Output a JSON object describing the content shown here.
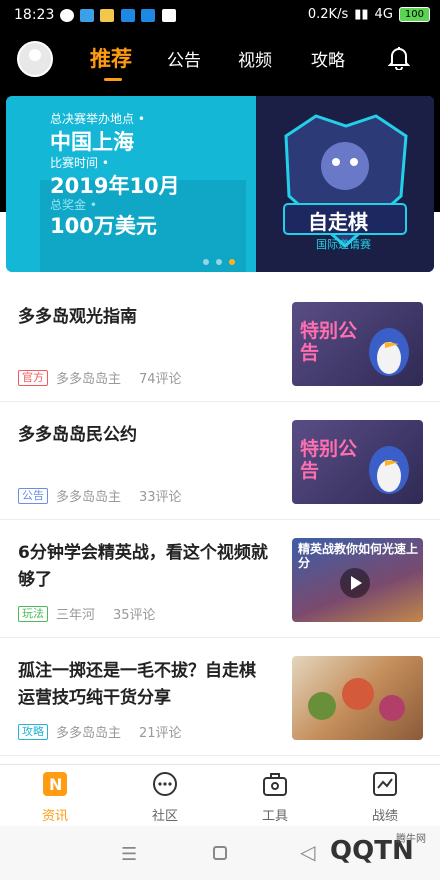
{
  "status": {
    "time": "18:23",
    "net": "0.2K/s",
    "signal": "4G",
    "battery": "100"
  },
  "nav": {
    "tabs": [
      {
        "label": "推荐"
      },
      {
        "label": "公告"
      },
      {
        "label": "视频"
      },
      {
        "label": "攻略"
      }
    ]
  },
  "banner": {
    "line1": "总决赛举办地点 •",
    "line2": "中国上海",
    "line3": "比赛时间 •",
    "line4": "2019年10月",
    "line5": "总奖金 •",
    "line6": "100万美元",
    "logo_text": "自走棋",
    "logo_sub": "国际邀请赛"
  },
  "articles": [
    {
      "title": "多多岛观光指南",
      "tag": "官方",
      "tag_color": "#f05a5a",
      "author": "多多岛岛主",
      "comments": "74评论",
      "thumb_text": "特别公告"
    },
    {
      "title": "多多岛岛民公约",
      "tag": "公告",
      "tag_color": "#6b8de8",
      "author": "多多岛岛主",
      "comments": "33评论",
      "thumb_text": "特别公告"
    },
    {
      "title": "6分钟学会精英战，看这个视频就够了",
      "tag": "玩法",
      "tag_color": "#4cba5a",
      "author": "三年河",
      "comments": "35评论",
      "thumb_text": "精英战教你如何光速上分"
    },
    {
      "title": "孤注一掷还是一毛不拔？自走棋运营技巧纯干货分享",
      "tag": "攻略",
      "tag_color": "#25b3d6",
      "author": "多多岛岛主",
      "comments": "21评论",
      "thumb_text": ""
    }
  ],
  "bottom_nav": [
    {
      "label": "资讯"
    },
    {
      "label": "社区"
    },
    {
      "label": "工具"
    },
    {
      "label": "战绩"
    }
  ],
  "watermark": "QQTN",
  "watermark_small": "腾牛网"
}
